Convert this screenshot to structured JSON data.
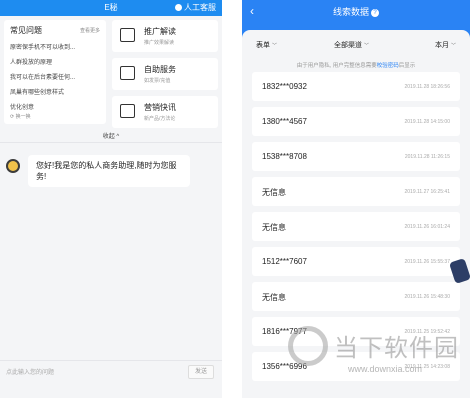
{
  "left": {
    "header": {
      "title": "E秘",
      "service": "人工客服"
    },
    "faq": {
      "title": "常见问题",
      "more": "查看更多",
      "questions": [
        "原密保手机不可以收到...",
        "人群投放的原理",
        "我可以在后台素要任何...",
        "凤巢有哪些创意样式",
        "优化创意"
      ],
      "refresh": "换一换"
    },
    "services": [
      {
        "name": "推广解读",
        "sub": "推广效果解读",
        "icon": "chart-icon"
      },
      {
        "name": "自助服务",
        "sub": "如发票/充值",
        "icon": "touch-icon"
      },
      {
        "name": "营销快讯",
        "sub": "新产品/方法论",
        "icon": "news-icon"
      }
    ],
    "collapse": "收起",
    "chat": {
      "message": "您好!我是您的私人商务助理,随时为您服务!"
    },
    "input": {
      "placeholder": "点此输入您的问题",
      "send": "发送"
    }
  },
  "right": {
    "header": {
      "back": "‹",
      "title": "线索数据",
      "help": "?"
    },
    "filters": {
      "type": "表单",
      "channel": "全部渠道",
      "period": "本月"
    },
    "notice": {
      "text": "由于用户隐私, 用户完整信息需要",
      "link": "校验密码",
      "suffix": "后显示"
    },
    "leads": [
      {
        "value": "1832***0932",
        "time": "2019.11.28 18:26:56"
      },
      {
        "value": "1380***4567",
        "time": "2019.11.28 14:15:00"
      },
      {
        "value": "1538***8708",
        "time": "2019.11.28 11:26:15"
      },
      {
        "value": "无信息",
        "time": "2019.11.27 16:25:41"
      },
      {
        "value": "无信息",
        "time": "2019.11.26 16:01:24"
      },
      {
        "value": "1512***7607",
        "time": "2019.11.26 15:55:37"
      },
      {
        "value": "无信息",
        "time": "2019.11.26 15:48:30"
      },
      {
        "value": "1816***7977",
        "time": "2019.11.25 19:52:42"
      },
      {
        "value": "1356***6996",
        "time": "2019.11.25 14:23:08"
      }
    ]
  },
  "watermark": {
    "big": "当下软件园",
    "small": "www.downxia.com"
  }
}
